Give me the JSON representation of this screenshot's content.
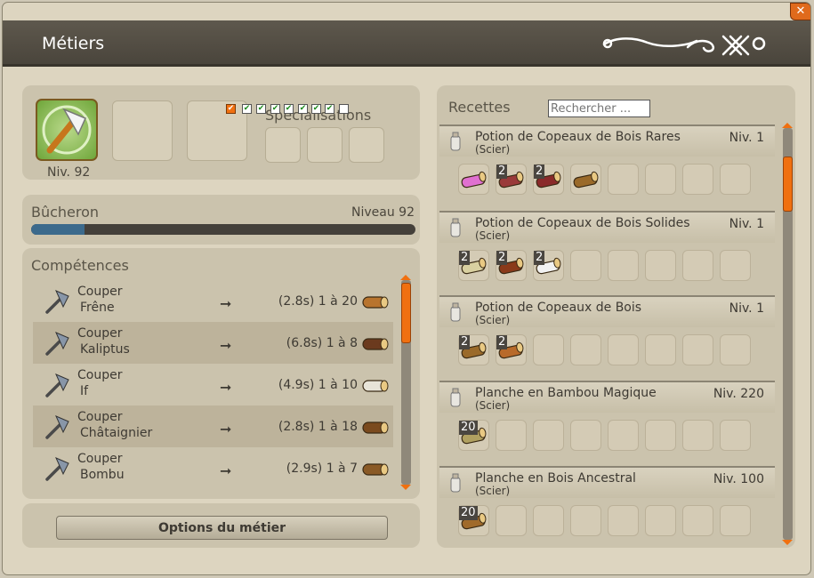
{
  "window": {
    "title": "Métiers"
  },
  "job": {
    "level_label": "Niv. 92",
    "specializations_label": "Spécialisations",
    "name": "Bûcheron",
    "level_text": "Niveau 92",
    "xp_progress": 0.14
  },
  "competences": {
    "title": "Compétences",
    "items": [
      {
        "action": "Couper",
        "resource": "Frêne",
        "timing": "(2.8s) 1 à 20",
        "icon": "ash-logs-icon"
      },
      {
        "action": "Couper",
        "resource": "Kaliptus",
        "timing": "(6.8s) 1 à 8",
        "icon": "kaliptus-log-icon"
      },
      {
        "action": "Couper",
        "resource": "If",
        "timing": "(4.9s) 1 à 10",
        "icon": "yew-log-icon"
      },
      {
        "action": "Couper",
        "resource": "Châtaignier",
        "timing": "(2.8s) 1 à 18",
        "icon": "chestnut-log-icon"
      },
      {
        "action": "Couper",
        "resource": "Bombu",
        "timing": "(2.9s) 1 à 7",
        "icon": "bombu-log-icon"
      }
    ]
  },
  "options_button": "Options du métier",
  "recettes": {
    "title": "Recettes",
    "search_placeholder": "Rechercher ...",
    "filters": [
      true,
      true,
      true,
      true,
      true,
      true,
      true,
      true,
      false
    ],
    "items": [
      {
        "name": "Potion de Copeaux de Bois Rares",
        "tool": "(Scier)",
        "level": "Niv. 1",
        "ingredients": [
          {
            "qty": "",
            "icon": "pink-log-icon"
          },
          {
            "qty": "2",
            "icon": "red-log-icon"
          },
          {
            "qty": "2",
            "icon": "dark-red-log-icon"
          },
          {
            "qty": "",
            "icon": "leafy-log-icon"
          }
        ]
      },
      {
        "name": "Potion de Copeaux de Bois Solides",
        "tool": "(Scier)",
        "level": "Niv. 1",
        "ingredients": [
          {
            "qty": "2",
            "icon": "pale-log-icon"
          },
          {
            "qty": "2",
            "icon": "burnt-log-icon"
          },
          {
            "qty": "2",
            "icon": "white-log-icon"
          }
        ]
      },
      {
        "name": "Potion de Copeaux de Bois",
        "tool": "(Scier)",
        "level": "Niv. 1",
        "ingredients": [
          {
            "qty": "2",
            "icon": "brown-log-icon"
          },
          {
            "qty": "2",
            "icon": "logs-icon"
          }
        ]
      },
      {
        "name": "Planche en Bambou Magique",
        "tool": "(Scier)",
        "level": "Niv. 220",
        "ingredients": [
          {
            "qty": "20",
            "icon": "bamboo-icon"
          }
        ]
      },
      {
        "name": "Planche en Bois Ancestral",
        "tool": "(Scier)",
        "level": "Niv. 100",
        "ingredients": [
          {
            "qty": "20",
            "icon": "ancestral-log-icon"
          }
        ]
      }
    ]
  },
  "colors": {
    "accent": "#f07010",
    "xp_bar": "#3c6a8c",
    "title_bar": "#524c43"
  }
}
